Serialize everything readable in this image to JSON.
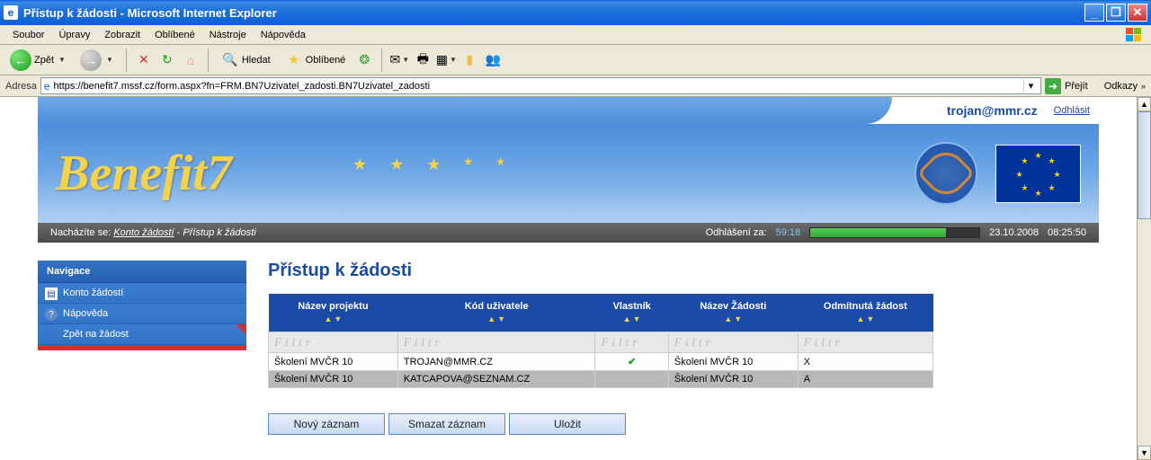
{
  "window": {
    "title": "Přístup k žádosti - Microsoft Internet Explorer"
  },
  "menu": {
    "items": [
      "Soubor",
      "Úpravy",
      "Zobrazit",
      "Oblíbené",
      "Nástroje",
      "Nápověda"
    ]
  },
  "toolbar": {
    "back": "Zpět",
    "search": "Hledat",
    "favorites": "Oblíbené"
  },
  "address": {
    "label": "Adresa",
    "url": "https://benefit7.mssf.cz/form.aspx?fn=FRM.BN7Uzivatel_zadosti.BN7Uzivatel_zadosti",
    "go": "Přejít",
    "links": "Odkazy"
  },
  "header": {
    "email": "trojan@mmr.cz",
    "logout": "Odhlásit",
    "brand": "Benefit7"
  },
  "status": {
    "breadcrumb_label": "Nacházíte se:",
    "breadcrumb_link": "Konto žádostí",
    "breadcrumb_current": "Přístup k žádosti",
    "logout_label": "Odhlášení za:",
    "logout_timer": "59:18",
    "date": "23.10.2008",
    "time": "08:25:50"
  },
  "nav": {
    "title": "Navigace",
    "items": [
      {
        "label": "Konto žádostí"
      },
      {
        "label": "Nápověda"
      },
      {
        "label": "Zpět na žádost"
      }
    ]
  },
  "page": {
    "title": "Přístup k žádosti",
    "columns": [
      "Název projektu",
      "Kód uživatele",
      "Vlastník",
      "Název Žádosti",
      "Odmítnutá žádost"
    ],
    "filter_placeholder": "Filtr",
    "rows": [
      {
        "projekt": "Školení MVČR 10",
        "kod": "TROJAN@MMR.CZ",
        "vlastnik": true,
        "zadost": "Školení MVČR 10",
        "odm": "X"
      },
      {
        "projekt": "Školení MVČR 10",
        "kod": "KATCAPOVA@SEZNAM.CZ",
        "vlastnik": false,
        "zadost": "Školení MVČR 10",
        "odm": "A"
      }
    ],
    "buttons": [
      "Nový záznam",
      "Smazat záznam",
      "Uložit"
    ]
  }
}
